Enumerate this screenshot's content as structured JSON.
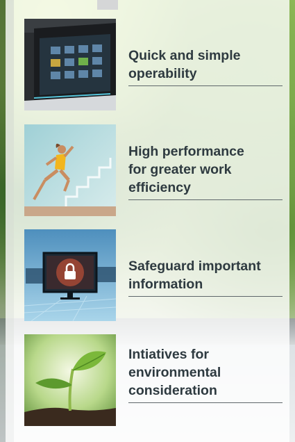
{
  "features": [
    {
      "title_lines": [
        "Quick and simple",
        "operability"
      ],
      "image": "printer-control-panel-image"
    },
    {
      "title_lines": [
        "High performance",
        "for greater work",
        "efficiency"
      ],
      "image": "running-woman-image"
    },
    {
      "title_lines": [
        "Safeguard important",
        "information"
      ],
      "image": "security-lock-monitor-image"
    },
    {
      "title_lines": [
        "Intiatives for",
        "environmental",
        "consideration"
      ],
      "image": "plant-sprout-image"
    }
  ]
}
